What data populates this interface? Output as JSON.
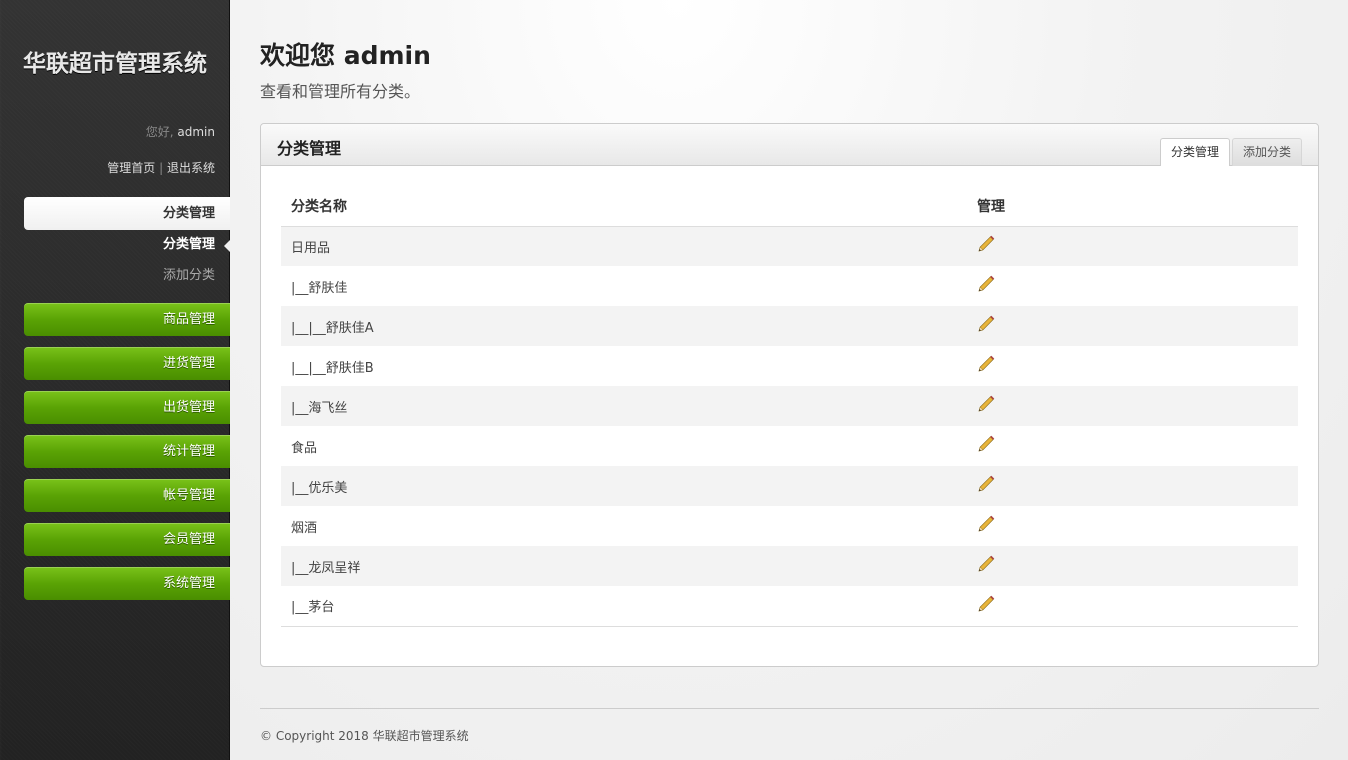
{
  "sidebar": {
    "title": "华联超市管理系统",
    "greeting_prefix": "您好, ",
    "username": "admin",
    "link_home": "管理首页",
    "link_sep": " | ",
    "link_logout": "退出系统",
    "current_section": "分类管理",
    "subnav": [
      {
        "label": "分类管理",
        "active": true
      },
      {
        "label": "添加分类",
        "active": false
      }
    ],
    "sections": [
      {
        "label": "商品管理"
      },
      {
        "label": "进货管理"
      },
      {
        "label": "出货管理"
      },
      {
        "label": "统计管理"
      },
      {
        "label": "帐号管理"
      },
      {
        "label": "会员管理"
      },
      {
        "label": "系统管理"
      }
    ]
  },
  "main": {
    "title": "欢迎您 admin",
    "subtitle": "查看和管理所有分类。",
    "box": {
      "heading": "分类管理",
      "tabs": [
        {
          "label": "分类管理",
          "active": true
        },
        {
          "label": "添加分类",
          "active": false
        }
      ],
      "columns": [
        "分类名称",
        "管理"
      ],
      "rows": [
        {
          "name": "日用品"
        },
        {
          "name": "|__舒肤佳"
        },
        {
          "name": "|__|__舒肤佳A"
        },
        {
          "name": "|__|__舒肤佳B"
        },
        {
          "name": "|__海飞丝"
        },
        {
          "name": "食品"
        },
        {
          "name": "|__优乐美"
        },
        {
          "name": "烟酒"
        },
        {
          "name": "|__龙凤呈祥"
        },
        {
          "name": "|__茅台"
        }
      ],
      "edit_icon": "pencil-edit-icon"
    }
  },
  "footer": {
    "text": "© Copyright 2018 华联超市管理系统"
  },
  "colors": {
    "accent_green": "#5aa305",
    "sidebar_bg": "#2a2a2a"
  }
}
